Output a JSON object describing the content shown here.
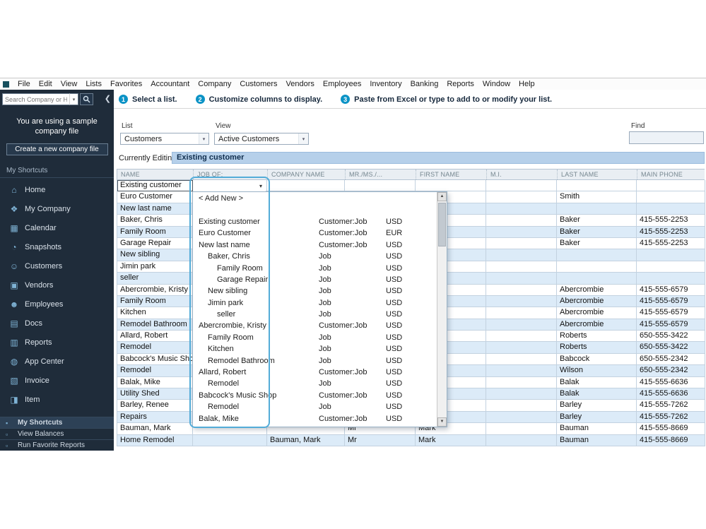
{
  "colors": {
    "sidebar_bg": "#1f2c3a",
    "accent_teal": "#0b93c6",
    "cell_highlight": "#53acd8",
    "row_alt": "#dcebf8",
    "editing_bar": "#b6d0ea"
  },
  "menu": {
    "items": [
      "File",
      "Edit",
      "View",
      "Lists",
      "Favorites",
      "Accountant",
      "Company",
      "Customers",
      "Vendors",
      "Employees",
      "Inventory",
      "Banking",
      "Reports",
      "Window",
      "Help"
    ]
  },
  "search": {
    "placeholder": "Search Company or Help"
  },
  "steps": [
    {
      "num": "1",
      "label": "Select a list."
    },
    {
      "num": "2",
      "label": "Customize columns to display."
    },
    {
      "num": "3",
      "label": "Paste from Excel or type to add to or modify your list."
    }
  ],
  "sidebar": {
    "banner": "You are using a sample company file",
    "create_button": "Create a new company file",
    "section": "My Shortcuts",
    "items": [
      {
        "label": "Home",
        "icon": "home-icon"
      },
      {
        "label": "My Company",
        "icon": "my-company-icon"
      },
      {
        "label": "Calendar",
        "icon": "calendar-icon"
      },
      {
        "label": "Snapshots",
        "icon": "snapshots-icon"
      },
      {
        "label": "Customers",
        "icon": "customers-icon"
      },
      {
        "label": "Vendors",
        "icon": "vendors-icon"
      },
      {
        "label": "Employees",
        "icon": "employees-icon"
      },
      {
        "label": "Docs",
        "icon": "docs-icon"
      },
      {
        "label": "Reports",
        "icon": "reports-icon"
      },
      {
        "label": "App Center",
        "icon": "app-center-icon"
      },
      {
        "label": "Invoice",
        "icon": "invoice-icon"
      },
      {
        "label": "Item",
        "icon": "item-icon"
      }
    ],
    "footer_items": [
      "My Shortcuts",
      "View Balances",
      "Run Favorite Reports"
    ]
  },
  "controls": {
    "list_label": "List",
    "list_value": "Customers",
    "view_label": "View",
    "view_value": "Active Customers",
    "find_label": "Find",
    "currently_editing_label": "Currently Editing:",
    "currently_editing_value": "Existing customer"
  },
  "table": {
    "columns": [
      "NAME",
      "JOB OF:",
      "COMPANY NAME",
      "MR./MS./...",
      "FIRST NAME",
      "M.I.",
      "LAST NAME",
      "MAIN PHONE"
    ],
    "rows": [
      {
        "name": "Existing customer",
        "company": "",
        "mr": "",
        "first": "",
        "mi": "",
        "last": "",
        "phone": ""
      },
      {
        "name": "Euro Customer",
        "company": "",
        "mr": "",
        "first": "",
        "mi": "",
        "last": "Smith",
        "phone": ""
      },
      {
        "name": "New last name",
        "company": "",
        "mr": "",
        "first": "",
        "mi": "",
        "last": "",
        "phone": ""
      },
      {
        "name": "Baker, Chris",
        "company": "",
        "mr": "",
        "first": "",
        "mi": "",
        "last": "Baker",
        "phone": "415-555-2253"
      },
      {
        "name": "Family Room",
        "company": "",
        "mr": "",
        "first": "",
        "mi": "",
        "last": "Baker",
        "phone": "415-555-2253"
      },
      {
        "name": "Garage Repair",
        "company": "",
        "mr": "",
        "first": "",
        "mi": "",
        "last": "Baker",
        "phone": "415-555-2253"
      },
      {
        "name": "New sibling",
        "company": "",
        "mr": "",
        "first": "",
        "mi": "",
        "last": "",
        "phone": ""
      },
      {
        "name": "Jimin park",
        "company": "",
        "mr": "",
        "first": "",
        "mi": "",
        "last": "",
        "phone": ""
      },
      {
        "name": "seller",
        "company": "",
        "mr": "",
        "first": "",
        "mi": "",
        "last": "",
        "phone": ""
      },
      {
        "name": "Abercrombie, Kristy",
        "company": "",
        "mr": "",
        "first": "",
        "mi": "",
        "last": "Abercrombie",
        "phone": "415-555-6579"
      },
      {
        "name": "Family Room",
        "company": "",
        "mr": "",
        "first": "",
        "mi": "",
        "last": "Abercrombie",
        "phone": "415-555-6579"
      },
      {
        "name": "Kitchen",
        "company": "",
        "mr": "",
        "first": "",
        "mi": "",
        "last": "Abercrombie",
        "phone": "415-555-6579"
      },
      {
        "name": "Remodel Bathroom",
        "company": "",
        "mr": "",
        "first": "",
        "mi": "",
        "last": "Abercrombie",
        "phone": "415-555-6579"
      },
      {
        "name": "Allard, Robert",
        "company": "",
        "mr": "",
        "first": "",
        "mi": "",
        "last": "Roberts",
        "phone": "650-555-3422"
      },
      {
        "name": "Remodel",
        "company": "",
        "mr": "",
        "first": "",
        "mi": "",
        "last": "Roberts",
        "phone": "650-555-3422"
      },
      {
        "name": "Babcock's Music Shop",
        "company": "",
        "mr": "",
        "first": "",
        "mi": "",
        "last": "Babcock",
        "phone": "650-555-2342"
      },
      {
        "name": "Remodel",
        "company": "",
        "mr": "",
        "first": "",
        "mi": "",
        "last": "Wilson",
        "phone": "650-555-2342"
      },
      {
        "name": "Balak, Mike",
        "company": "",
        "mr": "",
        "first": "",
        "mi": "",
        "last": "Balak",
        "phone": "415-555-6636"
      },
      {
        "name": "Utility Shed",
        "company": "",
        "mr": "",
        "first": "",
        "mi": "",
        "last": "Balak",
        "phone": "415-555-6636"
      },
      {
        "name": "Barley, Renee",
        "company": "",
        "mr": "",
        "first": "",
        "mi": "",
        "last": "Barley",
        "phone": "415-555-7262"
      },
      {
        "name": "Repairs",
        "company": "",
        "mr": "",
        "first": "",
        "mi": "",
        "last": "Barley",
        "phone": "415-555-7262"
      },
      {
        "name": "Bauman, Mark",
        "company": "",
        "mr": "Mr",
        "first": "Mark",
        "mi": "",
        "last": "Bauman",
        "phone": "415-555-8669"
      },
      {
        "name": "Home Remodel",
        "company": "Bauman, Mark",
        "mr": "Mr",
        "first": "Mark",
        "mi": "",
        "last": "Bauman",
        "phone": "415-555-8669"
      }
    ]
  },
  "dropdown": {
    "add_new": "< Add New >",
    "items": [
      {
        "name": "Existing customer",
        "indent": 0,
        "type": "Customer:Job",
        "currency": "USD"
      },
      {
        "name": "Euro Customer",
        "indent": 0,
        "type": "Customer:Job",
        "currency": "EUR"
      },
      {
        "name": "New last name",
        "indent": 0,
        "type": "Customer:Job",
        "currency": "USD"
      },
      {
        "name": "Baker, Chris",
        "indent": 1,
        "type": "Job",
        "currency": "USD"
      },
      {
        "name": "Family Room",
        "indent": 2,
        "type": "Job",
        "currency": "USD"
      },
      {
        "name": "Garage Repair",
        "indent": 2,
        "type": "Job",
        "currency": "USD"
      },
      {
        "name": "New sibling",
        "indent": 1,
        "type": "Job",
        "currency": "USD"
      },
      {
        "name": "Jimin park",
        "indent": 1,
        "type": "Job",
        "currency": "USD"
      },
      {
        "name": "seller",
        "indent": 2,
        "type": "Job",
        "currency": "USD"
      },
      {
        "name": "Abercrombie, Kristy",
        "indent": 0,
        "type": "Customer:Job",
        "currency": "USD"
      },
      {
        "name": "Family Room",
        "indent": 1,
        "type": "Job",
        "currency": "USD"
      },
      {
        "name": "Kitchen",
        "indent": 1,
        "type": "Job",
        "currency": "USD"
      },
      {
        "name": "Remodel Bathroom",
        "indent": 1,
        "type": "Job",
        "currency": "USD"
      },
      {
        "name": "Allard, Robert",
        "indent": 0,
        "type": "Customer:Job",
        "currency": "USD"
      },
      {
        "name": "Remodel",
        "indent": 1,
        "type": "Job",
        "currency": "USD"
      },
      {
        "name": "Babcock's Music Shop",
        "indent": 0,
        "type": "Customer:Job",
        "currency": "USD"
      },
      {
        "name": "Remodel",
        "indent": 1,
        "type": "Job",
        "currency": "USD"
      },
      {
        "name": "Balak, Mike",
        "indent": 0,
        "type": "Customer:Job",
        "currency": "USD"
      }
    ]
  }
}
